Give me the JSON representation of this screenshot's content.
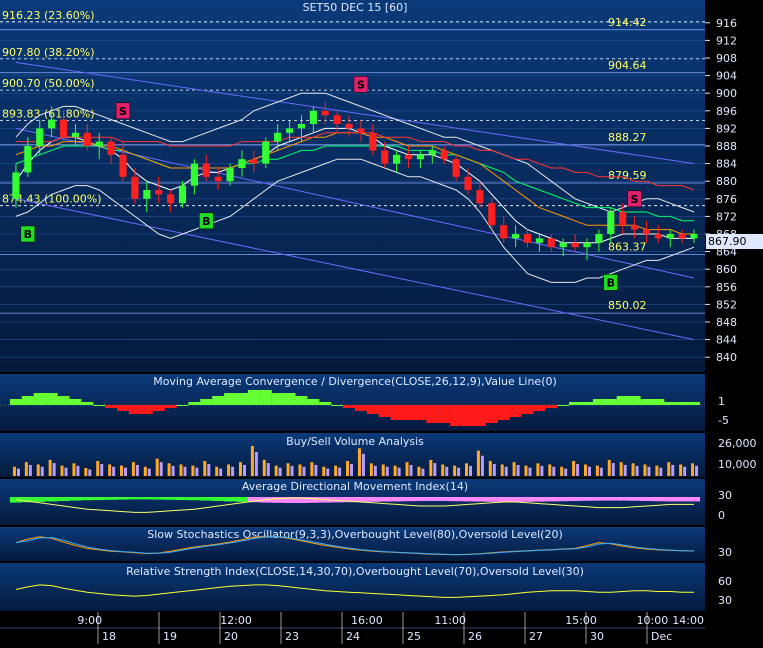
{
  "title": "SET50 DEC 15   [60]",
  "price_axis": {
    "ticks": [
      916,
      912,
      908,
      904,
      900,
      896,
      892,
      888,
      884,
      880,
      876,
      872,
      868,
      864,
      860,
      856,
      852,
      848,
      844,
      840
    ],
    "min": 838,
    "max": 918
  },
  "last_price": "867.90",
  "fib_levels": [
    {
      "label": "916.23 (23.60%)",
      "value": 916.23
    },
    {
      "label": "907.80 (38.20%)",
      "value": 907.8
    },
    {
      "label": "900.70 (50.00%)",
      "value": 900.7
    },
    {
      "label": "893.83 (61.80%)",
      "value": 893.83
    },
    {
      "label": "874.43 (100.00%)",
      "value": 874.43
    }
  ],
  "level_lines": [
    {
      "label": "914.42",
      "value": 914.42
    },
    {
      "label": "904.64",
      "value": 904.64
    },
    {
      "label": "888.27",
      "value": 888.27
    },
    {
      "label": "879.59",
      "value": 879.59
    },
    {
      "label": "863.37",
      "value": 863.37
    },
    {
      "label": "850.02",
      "value": 850.02
    }
  ],
  "signals": [
    {
      "type": "S",
      "bar": 9,
      "price": 896
    },
    {
      "type": "S",
      "bar": 29,
      "price": 902
    },
    {
      "type": "S",
      "bar": 52,
      "price": 876
    },
    {
      "type": "B",
      "bar": 1,
      "price": 868
    },
    {
      "type": "B",
      "bar": 16,
      "price": 871
    },
    {
      "type": "B",
      "bar": 50,
      "price": 857
    }
  ],
  "chart_data": {
    "type": "candlestick",
    "title": "SET50 DEC 15   [60]",
    "candles": [
      [
        876,
        884,
        874,
        882
      ],
      [
        882,
        890,
        881,
        888
      ],
      [
        888,
        894,
        886,
        892
      ],
      [
        892,
        897,
        890,
        894
      ],
      [
        894,
        896,
        889,
        890
      ],
      [
        890,
        893,
        888,
        891
      ],
      [
        891,
        893,
        887,
        888
      ],
      [
        888,
        891,
        885,
        889
      ],
      [
        889,
        890,
        884,
        886
      ],
      [
        886,
        889,
        880,
        881
      ],
      [
        881,
        883,
        875,
        876
      ],
      [
        876,
        880,
        873,
        878
      ],
      [
        878,
        881,
        875,
        877
      ],
      [
        877,
        878,
        873,
        875
      ],
      [
        875,
        880,
        874,
        879
      ],
      [
        879,
        885,
        877,
        884
      ],
      [
        884,
        886,
        880,
        881
      ],
      [
        881,
        883,
        878,
        880
      ],
      [
        880,
        884,
        879,
        883
      ],
      [
        883,
        887,
        881,
        885
      ],
      [
        885,
        887,
        882,
        884
      ],
      [
        884,
        890,
        883,
        889
      ],
      [
        889,
        893,
        887,
        891
      ],
      [
        891,
        894,
        889,
        892
      ],
      [
        892,
        895,
        889,
        893
      ],
      [
        893,
        897,
        891,
        896
      ],
      [
        896,
        898,
        893,
        895
      ],
      [
        895,
        896,
        891,
        893
      ],
      [
        893,
        895,
        890,
        892
      ],
      [
        892,
        894,
        889,
        891
      ],
      [
        891,
        893,
        886,
        887
      ],
      [
        887,
        889,
        883,
        884
      ],
      [
        884,
        887,
        882,
        886
      ],
      [
        886,
        888,
        883,
        885
      ],
      [
        885,
        887,
        883,
        886
      ],
      [
        886,
        888,
        884,
        887
      ],
      [
        887,
        888,
        884,
        885
      ],
      [
        885,
        886,
        880,
        881
      ],
      [
        881,
        883,
        877,
        878
      ],
      [
        878,
        880,
        874,
        875
      ],
      [
        875,
        876,
        869,
        870
      ],
      [
        870,
        872,
        866,
        867
      ],
      [
        867,
        870,
        865,
        868
      ],
      [
        868,
        869,
        865,
        866
      ],
      [
        866,
        868,
        864,
        867
      ],
      [
        867,
        868,
        864,
        865
      ],
      [
        865,
        867,
        863,
        866
      ],
      [
        866,
        868,
        864,
        865
      ],
      [
        865,
        867,
        862,
        866
      ],
      [
        866,
        869,
        864,
        868
      ],
      [
        868,
        874,
        866,
        873
      ],
      [
        873,
        875,
        868,
        870
      ],
      [
        870,
        872,
        867,
        869
      ],
      [
        869,
        871,
        866,
        868
      ],
      [
        868,
        870,
        866,
        867
      ],
      [
        867,
        869,
        865,
        868
      ],
      [
        868,
        869,
        866,
        867
      ],
      [
        867,
        869,
        866,
        868
      ]
    ],
    "series": [
      {
        "name": "",
        "color": "#ffffff",
        "values": [
          880,
          884,
          887,
          889,
          890,
          890,
          889,
          888,
          887,
          885,
          882,
          880,
          879,
          878,
          879,
          881,
          882,
          882,
          883,
          884,
          885,
          886,
          888,
          889,
          890,
          891,
          892,
          892,
          892,
          891,
          890,
          888,
          887,
          886,
          886,
          886,
          885,
          884,
          882,
          880,
          877,
          874,
          871,
          869,
          868,
          867,
          866,
          866,
          866,
          866,
          867,
          868,
          868,
          868,
          868,
          867,
          867,
          867
        ]
      },
      {
        "name": "",
        "color": "#00ff66",
        "values": [
          884,
          885,
          886,
          887,
          888,
          888,
          888,
          888,
          887,
          887,
          886,
          885,
          884,
          883,
          883,
          883,
          883,
          883,
          883,
          884,
          884,
          885,
          885,
          886,
          887,
          887,
          888,
          888,
          888,
          888,
          888,
          888,
          888,
          887,
          887,
          887,
          886,
          886,
          885,
          884,
          883,
          882,
          880,
          879,
          878,
          877,
          876,
          875,
          874,
          874,
          874,
          873,
          873,
          873,
          872,
          872,
          871,
          871
        ]
      },
      {
        "name": "",
        "color": "#ff9900",
        "values": [
          886,
          887,
          888,
          888,
          889,
          889,
          889,
          888,
          888,
          887,
          886,
          885,
          884,
          883,
          883,
          883,
          883,
          883,
          883,
          884,
          885,
          886,
          887,
          888,
          889,
          890,
          890,
          891,
          891,
          891,
          890,
          890,
          889,
          888,
          888,
          888,
          887,
          886,
          885,
          884,
          882,
          880,
          878,
          876,
          874,
          873,
          872,
          871,
          870,
          870,
          870,
          870,
          870,
          869,
          869,
          869,
          868,
          868
        ]
      },
      {
        "name": "",
        "color": "#ff3333",
        "values": [
          889,
          889,
          889,
          889,
          890,
          890,
          890,
          890,
          890,
          889,
          889,
          889,
          889,
          888,
          888,
          888,
          888,
          888,
          888,
          889,
          889,
          889,
          889,
          890,
          890,
          890,
          891,
          891,
          891,
          891,
          891,
          890,
          890,
          890,
          889,
          889,
          889,
          888,
          888,
          887,
          887,
          886,
          885,
          885,
          884,
          883,
          883,
          882,
          882,
          881,
          881,
          881,
          880,
          880,
          879,
          879,
          879,
          878
        ]
      }
    ],
    "bands_upper": [
      890,
      893,
      895,
      896,
      897,
      897,
      896,
      895,
      894,
      893,
      892,
      891,
      890,
      889,
      889,
      890,
      891,
      892,
      893,
      894,
      896,
      897,
      898,
      899,
      900,
      900,
      900,
      899,
      898,
      897,
      896,
      895,
      894,
      893,
      892,
      891,
      890,
      890,
      889,
      888,
      887,
      886,
      885,
      884,
      882,
      880,
      878,
      876,
      875,
      874,
      873,
      874,
      875,
      876,
      876,
      875,
      874,
      873
    ],
    "bands_lower": [
      872,
      873,
      875,
      877,
      878,
      879,
      879,
      878,
      876,
      874,
      872,
      870,
      868,
      867,
      868,
      869,
      870,
      871,
      872,
      874,
      876,
      878,
      880,
      881,
      882,
      883,
      884,
      885,
      885,
      885,
      884,
      883,
      882,
      881,
      881,
      880,
      879,
      878,
      876,
      873,
      869,
      865,
      862,
      859,
      858,
      857,
      857,
      857,
      858,
      858,
      859,
      860,
      861,
      862,
      862,
      863,
      864,
      865
    ],
    "trendlines": [
      {
        "from": [
          0,
          907
        ],
        "to": [
          57,
          884
        ]
      },
      {
        "from": [
          0,
          892
        ],
        "to": [
          57,
          858
        ]
      },
      {
        "from": [
          0,
          876
        ],
        "to": [
          57,
          844
        ]
      }
    ],
    "date_axis": {
      "time_labels": [
        "9:00",
        "12:00",
        "16:00",
        "11:00",
        "15:00",
        "10:00",
        "14:00"
      ],
      "day_labels": [
        "18",
        "19",
        "20",
        "23",
        "24",
        "25",
        "26",
        "27",
        "30",
        "Dec"
      ]
    }
  },
  "panels": {
    "macd": {
      "title": "Moving Average Convergence / Divergence(CLOSE,26,12,9),Value Line(0)",
      "ticks": [
        "1",
        "-5"
      ],
      "values": [
        2,
        3,
        4,
        4,
        3,
        2,
        1,
        0,
        -1,
        -2,
        -3,
        -3,
        -2,
        -1,
        0,
        1,
        2,
        3,
        4,
        4,
        5,
        5,
        4,
        4,
        3,
        2,
        1,
        0,
        -1,
        -2,
        -3,
        -4,
        -5,
        -5,
        -5,
        -6,
        -6,
        -7,
        -7,
        -7,
        -6,
        -5,
        -4,
        -3,
        -2,
        -1,
        0,
        1,
        1,
        2,
        2,
        3,
        3,
        2,
        2,
        1,
        1,
        1
      ]
    },
    "volume": {
      "title": "Buy/Sell Volume Analysis",
      "ticks": [
        "26,000",
        "10,000"
      ],
      "values": [
        8,
        12,
        10,
        14,
        9,
        11,
        7,
        13,
        10,
        9,
        12,
        8,
        15,
        11,
        10,
        9,
        13,
        8,
        10,
        12,
        26,
        14,
        9,
        11,
        10,
        12,
        8,
        9,
        13,
        24,
        11,
        10,
        9,
        12,
        8,
        14,
        10,
        9,
        11,
        22,
        13,
        10,
        12,
        9,
        11,
        10,
        8,
        13,
        10,
        9,
        14,
        12,
        11,
        10,
        9,
        12,
        10,
        11
      ]
    },
    "adx": {
      "title": "Average Directional Movement Index(14)",
      "ticks": [
        "30",
        "0"
      ],
      "values": [
        28,
        26,
        24,
        22,
        20,
        18,
        16,
        15,
        14,
        13,
        12,
        12,
        13,
        14,
        15,
        16,
        18,
        20,
        22,
        24,
        26,
        28,
        29,
        30,
        30,
        29,
        28,
        27,
        26,
        25,
        24,
        23,
        22,
        21,
        20,
        20,
        20,
        21,
        22,
        23,
        24,
        25,
        25,
        24,
        23,
        22,
        21,
        20,
        19,
        18,
        18,
        18,
        19,
        20,
        21,
        22,
        22,
        22
      ]
    },
    "stoch": {
      "title": "Slow Stochastics Oscillator(9,3,3),Overbought Level(80),Oversold Level(20)",
      "ticks": [
        "30"
      ],
      "values": [
        60,
        72,
        80,
        75,
        62,
        50,
        40,
        35,
        30,
        28,
        25,
        22,
        24,
        30,
        38,
        45,
        50,
        55,
        62,
        70,
        78,
        82,
        80,
        74,
        66,
        58,
        50,
        44,
        38,
        34,
        30,
        28,
        26,
        24,
        22,
        20,
        19,
        18,
        20,
        22,
        25,
        28,
        30,
        32,
        34,
        36,
        38,
        40,
        50,
        60,
        56,
        48,
        42,
        38,
        35,
        33,
        32,
        31
      ]
    },
    "rsi": {
      "title": "Relative Strength Index(CLOSE,14,30,70),Overbought Level(70),Oversold Level(30)",
      "ticks": [
        "60",
        "30"
      ],
      "values": [
        48,
        52,
        55,
        54,
        50,
        47,
        44,
        42,
        40,
        39,
        38,
        39,
        41,
        43,
        45,
        47,
        49,
        51,
        53,
        54,
        55,
        55,
        54,
        52,
        50,
        48,
        46,
        45,
        44,
        43,
        42,
        41,
        40,
        39,
        38,
        37,
        36,
        36,
        37,
        38,
        39,
        40,
        42,
        44,
        45,
        46,
        46,
        46,
        45,
        44,
        44,
        45,
        46,
        46,
        45,
        45,
        44,
        44
      ]
    }
  }
}
